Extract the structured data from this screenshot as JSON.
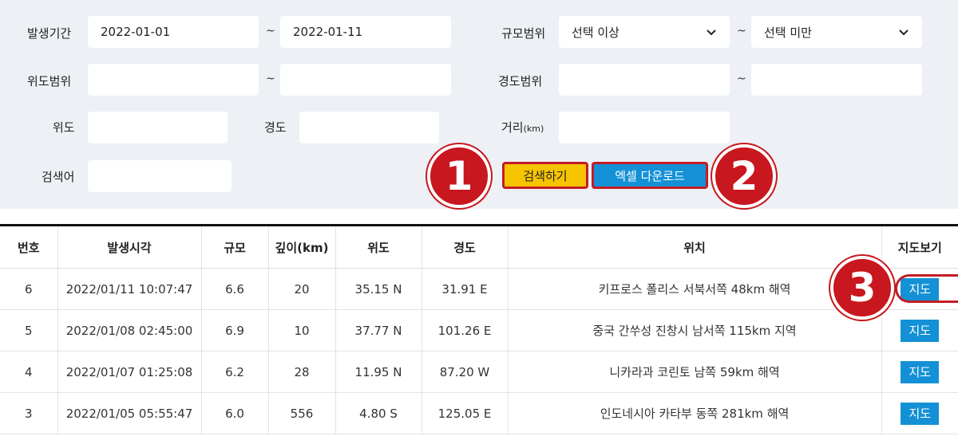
{
  "search": {
    "period_label": "발생기간",
    "period_from": "2022-01-01",
    "period_to": "2022-01-11",
    "magnitude_label": "규모범위",
    "magnitude_min": "선택 이상",
    "magnitude_max": "선택 미만",
    "lat_range_label": "위도범위",
    "lat_range_from": "",
    "lat_range_to": "",
    "lon_range_label": "경도범위",
    "lon_range_from": "",
    "lon_range_to": "",
    "lat_label": "위도",
    "lat_value": "",
    "lon_label": "경도",
    "lon_value": "",
    "distance_label": "거리",
    "distance_unit": "(km)",
    "distance_value": "",
    "keyword_label": "검색어",
    "keyword_value": "",
    "tilde": "~",
    "search_button": "검색하기",
    "excel_button": "엑셀 다운로드"
  },
  "callouts": [
    "1",
    "2",
    "3"
  ],
  "colors": {
    "accent_yellow": "#f7c400",
    "accent_blue": "#1491d6",
    "callout_red": "#c8171e",
    "panel_bg": "#edf0f5"
  },
  "table": {
    "headers": [
      "번호",
      "발생시각",
      "규모",
      "깊이(km)",
      "위도",
      "경도",
      "위치",
      "지도보기"
    ],
    "rows": [
      {
        "no": "6",
        "time": "2022/01/11 10:07:47",
        "mag": "6.6",
        "depth": "20",
        "lat": "35.15 N",
        "lon": "31.91 E",
        "location": "키프로스 폴리스 서북서쪽 48km 해역",
        "map": "지도"
      },
      {
        "no": "5",
        "time": "2022/01/08 02:45:00",
        "mag": "6.9",
        "depth": "10",
        "lat": "37.77 N",
        "lon": "101.26 E",
        "location": "중국 간쑤성 진창시 남서쪽 115km 지역",
        "map": "지도"
      },
      {
        "no": "4",
        "time": "2022/01/07 01:25:08",
        "mag": "6.2",
        "depth": "28",
        "lat": "11.95 N",
        "lon": "87.20 W",
        "location": "니카라과 코린토 남쪽 59km 해역",
        "map": "지도"
      },
      {
        "no": "3",
        "time": "2022/01/05 05:55:47",
        "mag": "6.0",
        "depth": "556",
        "lat": "4.80 S",
        "lon": "125.05 E",
        "location": "인도네시아 카타부 동쪽 281km 해역",
        "map": "지도"
      }
    ]
  }
}
